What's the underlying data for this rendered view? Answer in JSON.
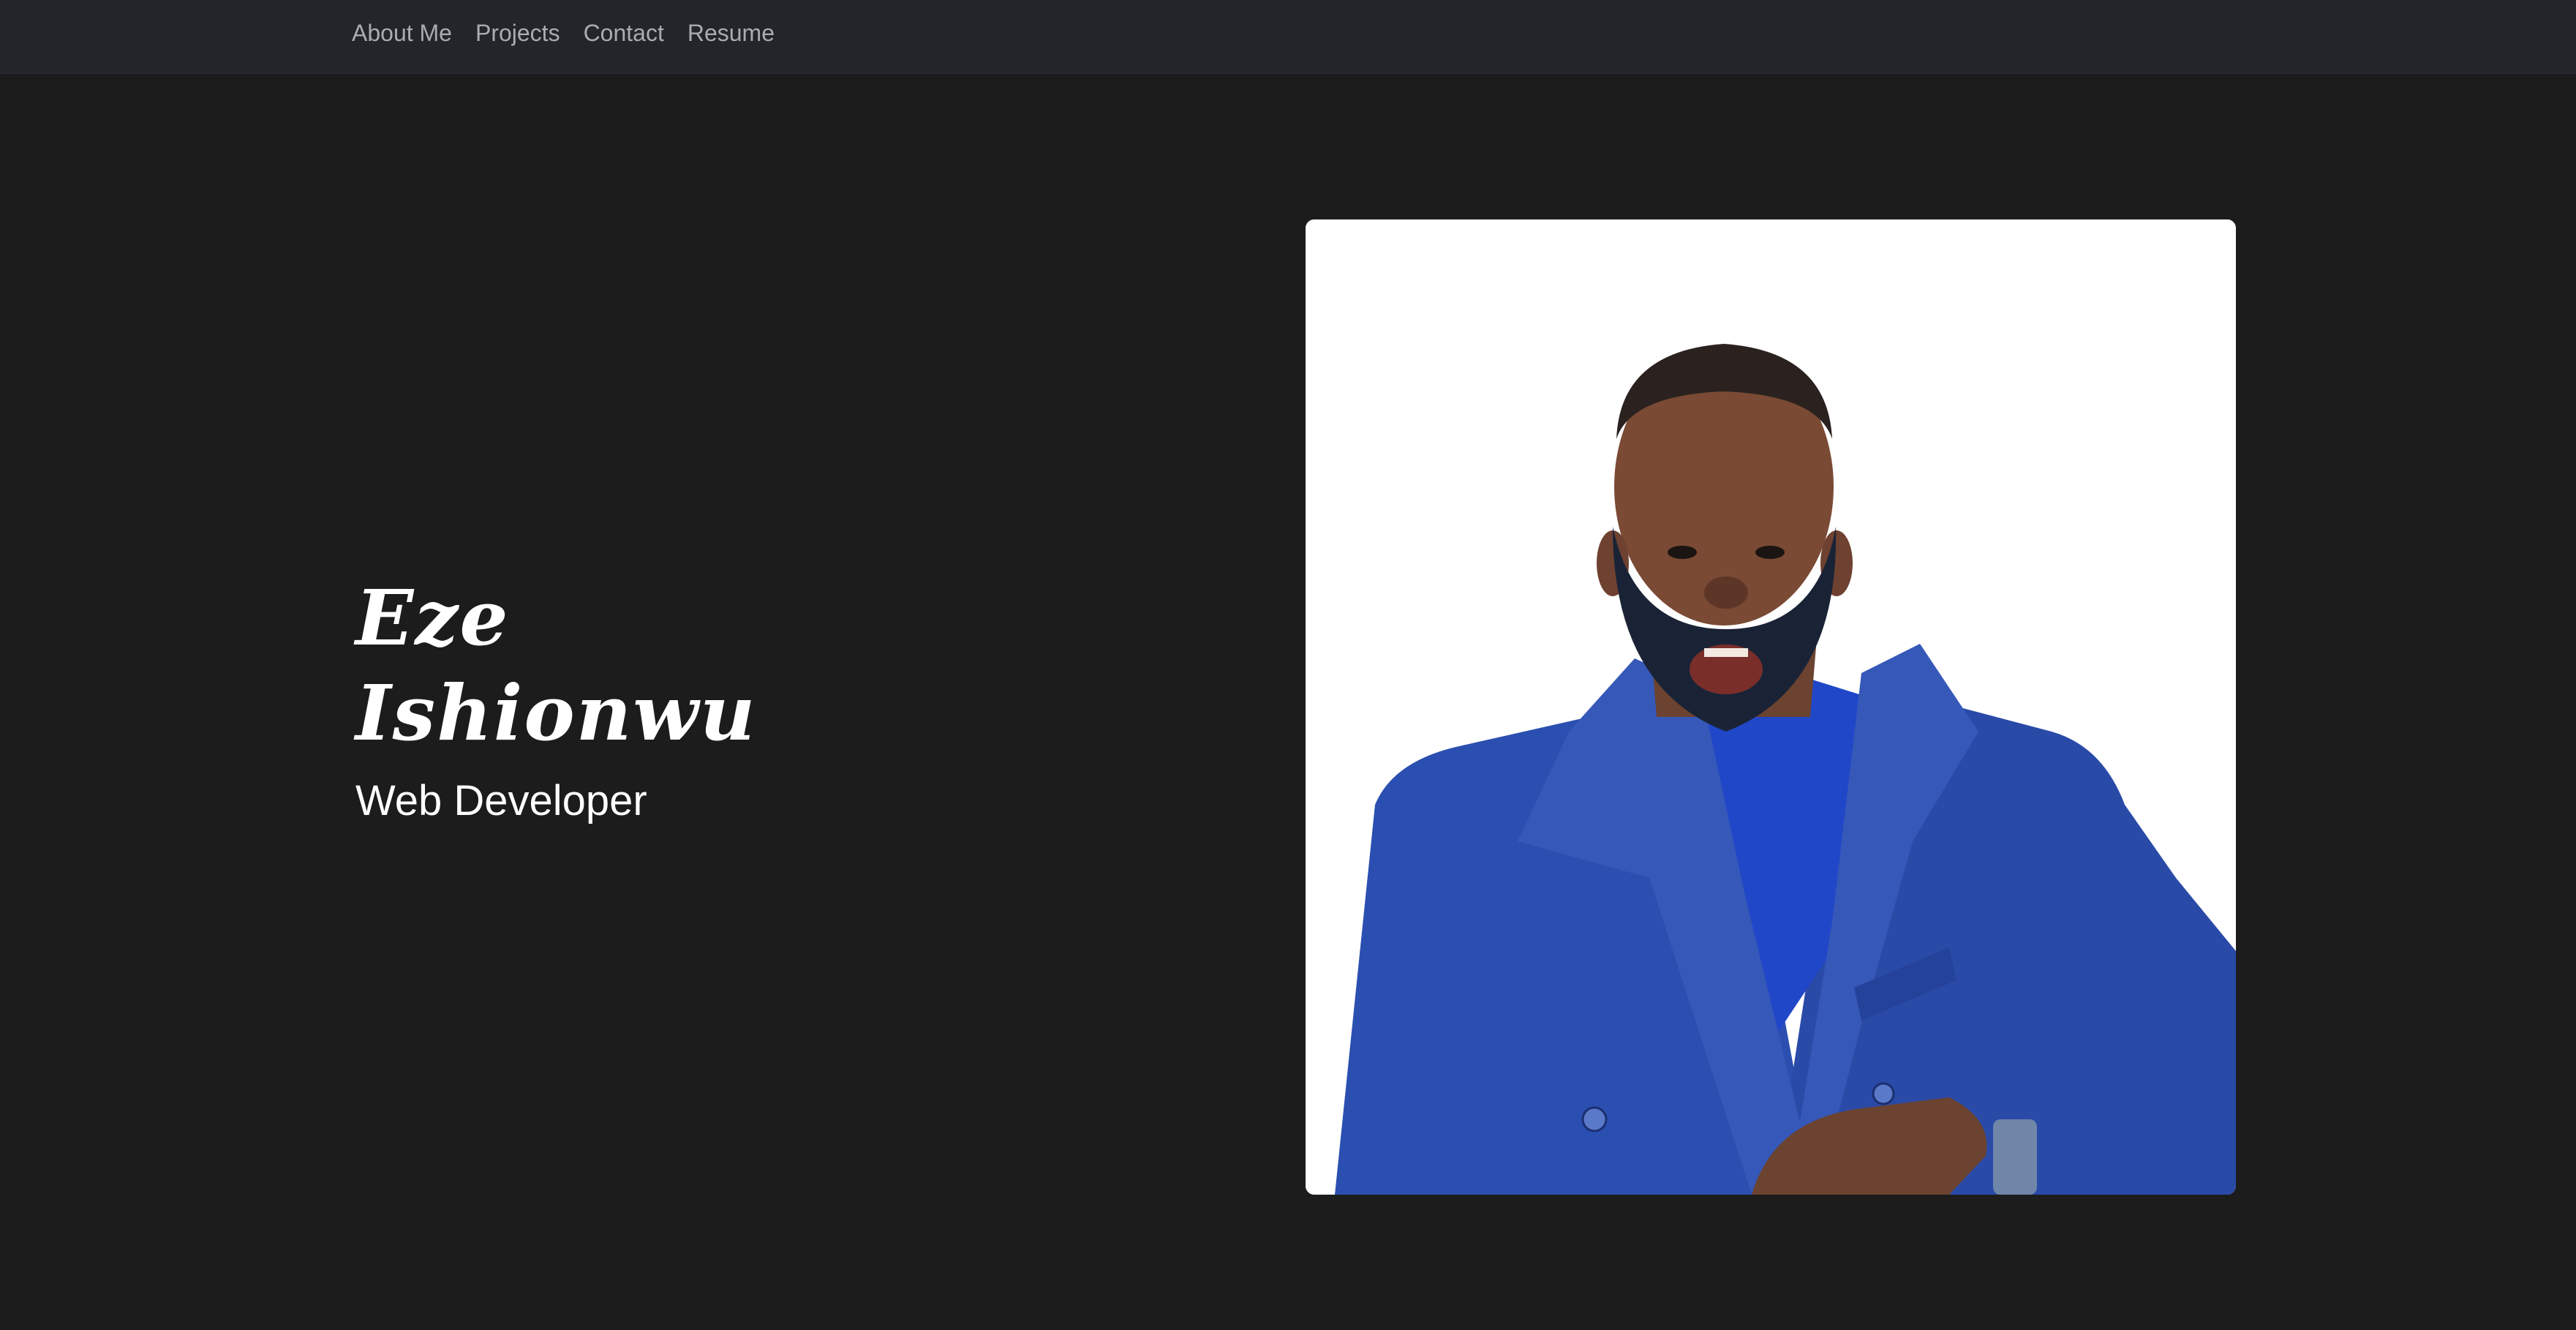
{
  "nav": {
    "items": [
      {
        "label": "About Me"
      },
      {
        "label": "Projects"
      },
      {
        "label": "Contact"
      },
      {
        "label": "Resume"
      }
    ]
  },
  "hero": {
    "name_line1": "Eze",
    "name_line2": "Ishionwu",
    "role": "Web Developer"
  },
  "colors": {
    "page_bg": "#1c1c1c",
    "navbar_bg": "#22252a",
    "nav_text": "#a9acb0",
    "coat_blue": "#2b4fb0"
  }
}
